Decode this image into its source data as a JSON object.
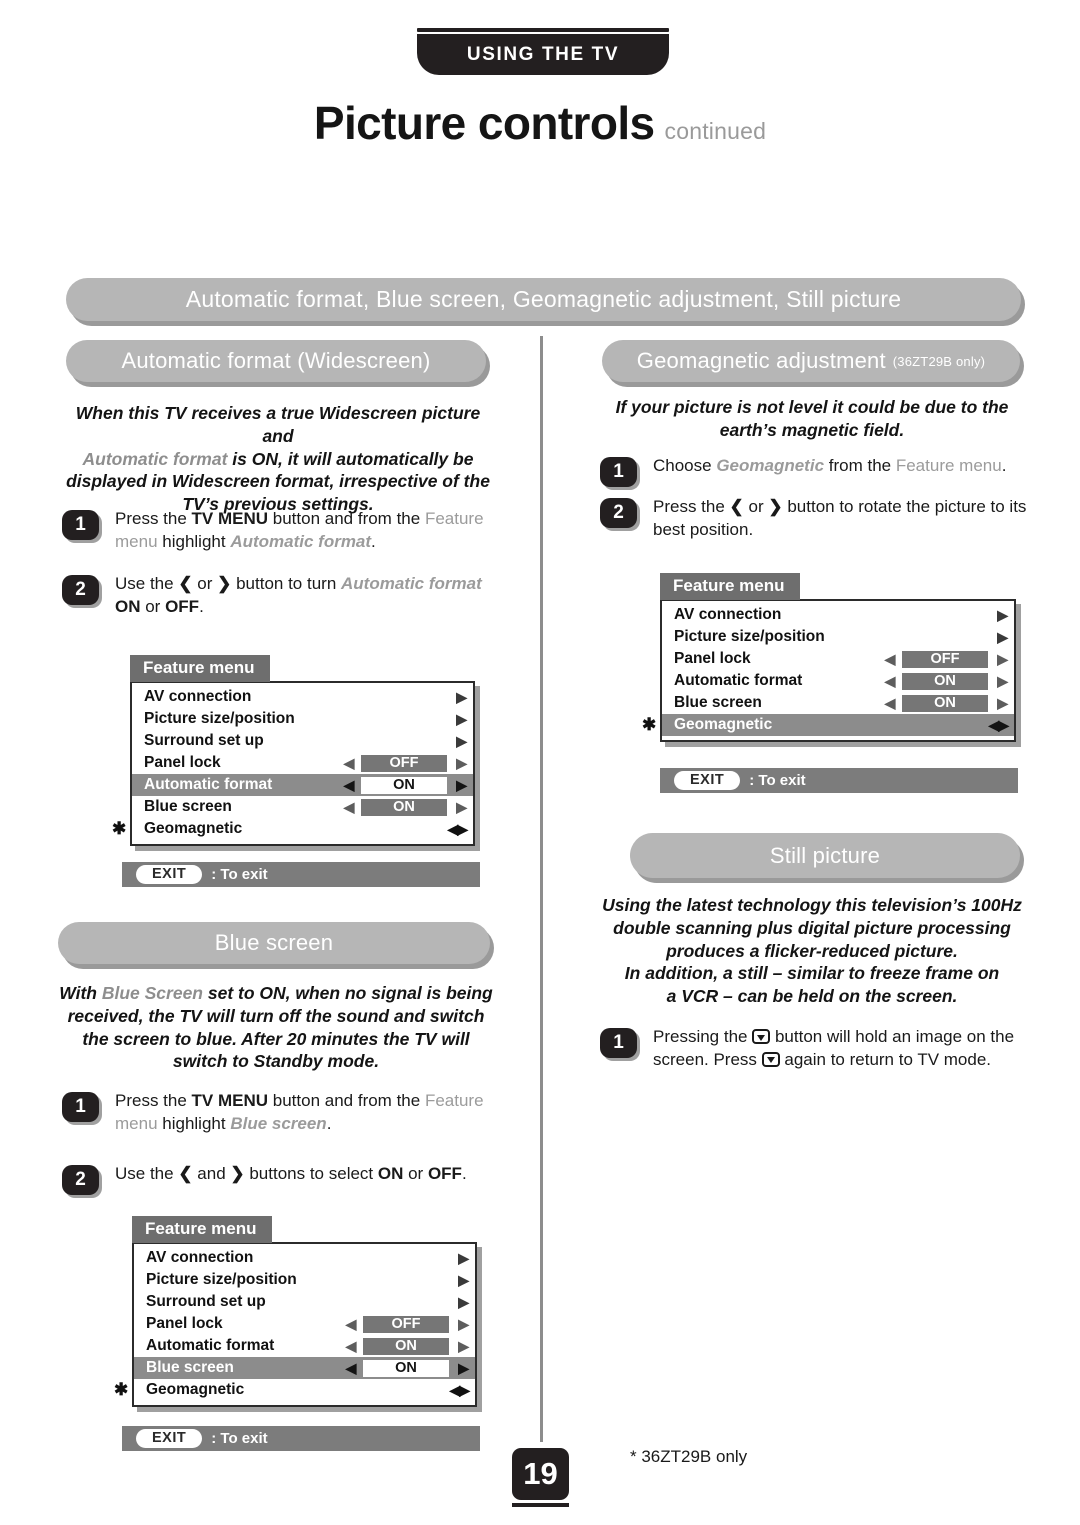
{
  "banner": {
    "label": "USING THE TV"
  },
  "title": {
    "main": "Picture controls",
    "continued": "continued"
  },
  "pills": {
    "master": "Automatic format, Blue screen, Geomagnetic adjustment, Still picture",
    "automatic_format": "Automatic format (Widescreen)",
    "geomagnetic": "Geomagnetic adjustment",
    "geomagnetic_sub": "(36ZT29B only)",
    "blue_screen": "Blue screen",
    "still_picture": "Still picture"
  },
  "blurbs": {
    "automatic_format": {
      "l1_a": "When this TV receives a true Widescreen picture and",
      "l2_gray": "Automatic format",
      "l2_b": " is ON, it will automatically be",
      "l3": "displayed in Widescreen format, irrespective of the",
      "l4": "TV’s previous settings."
    },
    "geomagnetic": {
      "l1": "If your picture is not level it could be due to the",
      "l2": "earth’s magnetic field."
    },
    "blue_screen": {
      "l1_a": "With ",
      "l1_gray": "Blue Screen",
      "l1_b": " set to ON, when no signal is being",
      "l2": "received, the TV will turn off the sound and switch",
      "l3": "the screen to blue. After 20 minutes the TV will",
      "l4": "switch to Standby mode."
    },
    "still_picture": {
      "l1": "Using the latest technology this television’s 100Hz",
      "l2": "double scanning plus digital picture processing",
      "l3": "produces a flicker-reduced picture.",
      "l4": "In addition, a still – similar to freeze frame on",
      "l5": "a VCR – can be held on the screen."
    }
  },
  "steps": {
    "auto1": {
      "num": "1",
      "t1": "Press the ",
      "b1": "TV MENU",
      "t2": " button and from the ",
      "g1": "Feature menu",
      "t3": " highlight ",
      "gi1": "Automatic format",
      "t4": "."
    },
    "auto2": {
      "num": "2",
      "t1": "Use the ",
      "a1": "❮",
      "t2": " or ",
      "a2": "❯",
      "t3": " button to turn ",
      "gi1": "Automatic format",
      "t4": " ",
      "b1": "ON",
      "t5": " or ",
      "b2": "OFF",
      "t6": "."
    },
    "blue1": {
      "num": "1",
      "t1": "Press the ",
      "b1": "TV MENU",
      "t2": " button and from the ",
      "g1": "Feature menu",
      "t3": " highlight ",
      "gi1": "Blue screen",
      "t4": "."
    },
    "blue2": {
      "num": "2",
      "t1": "Use the ",
      "a1": "❮",
      "t2": " and ",
      "a2": "❯",
      "t3": " buttons to select ",
      "b1": "ON",
      "t4": " or ",
      "b2": "OFF",
      "t5": "."
    },
    "geo1": {
      "num": "1",
      "t1": "Choose ",
      "g1": "Geomagnetic",
      "t2": " from the ",
      "g2": "Feature menu",
      "t3": "."
    },
    "geo2": {
      "num": "2",
      "t1": "Press the ",
      "a1": "❮",
      "t2": " or ",
      "a2": "❯",
      "t3": " button to rotate the picture to its best position."
    },
    "still1": {
      "num": "1",
      "t1": "Pressing the ",
      "t2": " button will hold an image on the screen. Press ",
      "t3": " again to return to TV mode."
    }
  },
  "osd": {
    "tab_label": "Feature menu",
    "exit_button": "EXIT",
    "exit_text": ": To exit",
    "star": "✱",
    "arrow_left": "◀",
    "arrow_right": "▶",
    "submenu_arrow": "▶",
    "menu1": {
      "rows": [
        {
          "label": "AV connection",
          "kind": "submenu",
          "value": "",
          "selected": false,
          "star": false
        },
        {
          "label": "Picture size/position",
          "kind": "submenu",
          "value": "",
          "selected": false,
          "star": false
        },
        {
          "label": "Surround set up",
          "kind": "submenu",
          "value": "",
          "selected": false,
          "star": false
        },
        {
          "label": "Panel lock",
          "kind": "value",
          "value": "OFF",
          "selected": false,
          "star": false
        },
        {
          "label": "Automatic format",
          "kind": "value",
          "value": "ON",
          "selected": true,
          "star": false
        },
        {
          "label": "Blue screen",
          "kind": "value",
          "value": "ON",
          "selected": false,
          "star": false
        },
        {
          "label": "Geomagnetic",
          "kind": "pair",
          "value": "",
          "selected": false,
          "star": true
        }
      ]
    },
    "menu2": {
      "rows": [
        {
          "label": "AV connection",
          "kind": "submenu",
          "value": "",
          "selected": false,
          "star": false
        },
        {
          "label": "Picture size/position",
          "kind": "submenu",
          "value": "",
          "selected": false,
          "star": false
        },
        {
          "label": "Surround set up",
          "kind": "submenu",
          "value": "",
          "selected": false,
          "star": false
        },
        {
          "label": "Panel lock",
          "kind": "value",
          "value": "OFF",
          "selected": false,
          "star": false
        },
        {
          "label": "Automatic format",
          "kind": "value",
          "value": "ON",
          "selected": false,
          "star": false
        },
        {
          "label": "Blue screen",
          "kind": "value",
          "value": "ON",
          "selected": true,
          "star": false
        },
        {
          "label": "Geomagnetic",
          "kind": "pair",
          "value": "",
          "selected": false,
          "star": true
        }
      ]
    },
    "menu3": {
      "rows": [
        {
          "label": "AV connection",
          "kind": "submenu",
          "value": "",
          "selected": false,
          "star": false
        },
        {
          "label": "Picture size/position",
          "kind": "submenu",
          "value": "",
          "selected": false,
          "star": false
        },
        {
          "label": "Panel lock",
          "kind": "value",
          "value": "OFF",
          "selected": false,
          "star": false
        },
        {
          "label": "Automatic format",
          "kind": "value",
          "value": "ON",
          "selected": false,
          "star": false
        },
        {
          "label": "Blue screen",
          "kind": "value",
          "value": "ON",
          "selected": false,
          "star": false
        },
        {
          "label": "Geomagnetic",
          "kind": "pair",
          "value": "",
          "selected": true,
          "star": true
        }
      ]
    }
  },
  "footer": {
    "page_number": "19",
    "footnote": "* 36ZT29B only"
  },
  "colors": {
    "ink": "#231f20",
    "pill_gray": "#b6b6b6",
    "osd_tab_gray": "#6e6e6e",
    "osd_select_gray": "#8c8c8c",
    "osd_value_gray": "#767676",
    "exit_bar_gray": "#7c7c7c",
    "body_gray_text": "#9b9b9b"
  }
}
